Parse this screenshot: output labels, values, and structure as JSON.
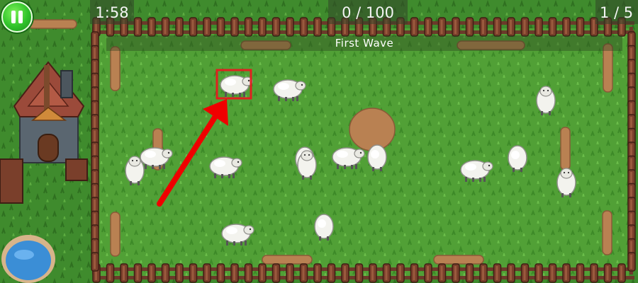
{
  "hud": {
    "timer": "1:58",
    "score": "0 / 100",
    "wave_counter": "1 / 5",
    "wave_banner": "First Wave"
  },
  "icons": {
    "pause": "pause-icon"
  },
  "colors": {
    "grass": "#4f9a34",
    "fence": "#6b3a2a",
    "highlight_box": "#e02020",
    "arrow": "#f00000",
    "pause_button": "#2fc32a"
  }
}
